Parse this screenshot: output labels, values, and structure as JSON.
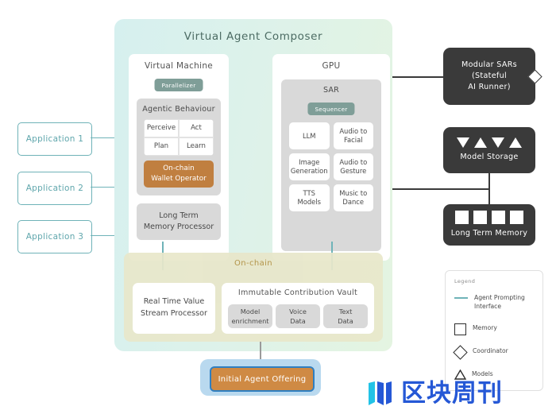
{
  "composer": {
    "title": "Virtual Agent Composer",
    "virtual_machine": {
      "title": "Virtual Machine",
      "badge": "Parallelizer",
      "agentic_behaviour": {
        "title": "Agentic Behaviour",
        "cells": [
          "Perceive",
          "Act",
          "Plan",
          "Learn"
        ],
        "wallet_operator": "On-chain\nWallet Operator"
      },
      "long_term_memory_processor": "Long Term\nMemory Processor"
    },
    "gpu": {
      "title": "GPU",
      "sar": {
        "title": "SAR",
        "badge": "Sequencer",
        "modules": [
          "LLM",
          "Audio to\nFacial",
          "Image\nGeneration",
          "Audio to\nGesture",
          "TTS\nModels",
          "Music to\nDance"
        ]
      }
    },
    "onchain": {
      "title": "On-chain",
      "stream_processor": "Real Time Value\nStream Processor",
      "vault": {
        "title": "Immutable Contribution Vault",
        "items": [
          "Model\nenrichment",
          "Voice\nData",
          "Text\nData"
        ]
      }
    }
  },
  "applications": [
    {
      "label": "Application 1"
    },
    {
      "label": "Application 2"
    },
    {
      "label": "Application 3"
    }
  ],
  "right_nodes": [
    {
      "id": "modular-sars",
      "label": "Modular SARs\n(Stateful\nAI Runner)",
      "shape": "diamond"
    },
    {
      "id": "model-storage",
      "label": "Model Storage",
      "shape": "triangles"
    },
    {
      "id": "long-term-memory",
      "label": "Long Term Memory",
      "shape": "squares"
    }
  ],
  "initial_agent_offering": {
    "label": "Initial Agent Offering"
  },
  "legend": {
    "title": "Legend",
    "items": [
      {
        "glyph": "line",
        "label": "Agent Prompting Interface"
      },
      {
        "glyph": "square",
        "label": "Memory"
      },
      {
        "glyph": "diamond",
        "label": "Coordinator"
      },
      {
        "glyph": "triangle",
        "label": "Models"
      }
    ]
  },
  "watermark": {
    "text": "区块周刊"
  },
  "colors": {
    "teal": "#6fb3b8",
    "orange": "#c07f40",
    "dark": "#3a3a3a",
    "gray": "#d9d9d9",
    "onchain_bg": "#e8e7ca",
    "onchain_text": "#b08d3c",
    "badge": "#7f9e98",
    "iao_outer": "#b9d9ef",
    "iao_inner": "#cf8a44",
    "watermark": "#2558d6"
  }
}
